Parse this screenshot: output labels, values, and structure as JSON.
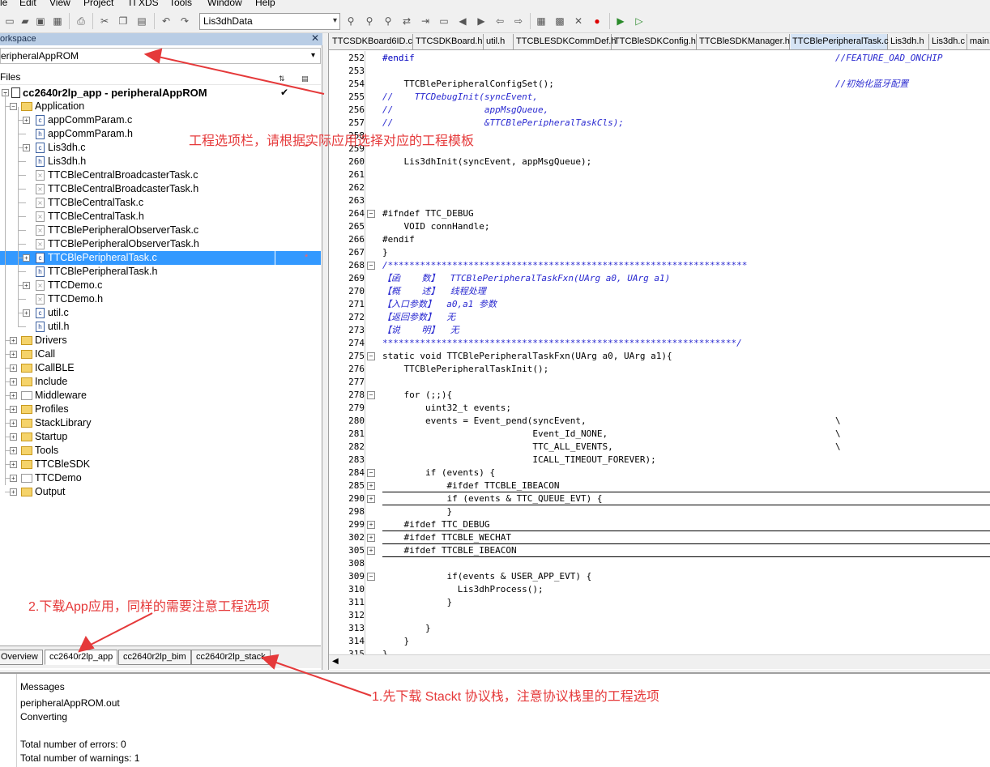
{
  "menu": [
    "le",
    "Edit",
    "View",
    "Project",
    "TI XDS",
    "Tools",
    "Window",
    "Help"
  ],
  "toolbar": {
    "config_combo": "Lis3dhData"
  },
  "workspace": {
    "title": "orkspace",
    "project_select": "eripheralAppROM",
    "files_label": "Files",
    "root": "cc2640r2lp_app - peripheralAppROM",
    "tree": [
      {
        "label": "Application",
        "kind": "folder",
        "level": 1,
        "exp": "−"
      },
      {
        "label": "appCommParam.c",
        "kind": "c",
        "level": 2,
        "exp": "+"
      },
      {
        "label": "appCommParam.h",
        "kind": "h",
        "level": 2,
        "exp": ""
      },
      {
        "label": "Lis3dh.c",
        "kind": "c",
        "level": 2,
        "exp": "+",
        "mark": "*"
      },
      {
        "label": "Lis3dh.h",
        "kind": "h",
        "level": 2,
        "exp": ""
      },
      {
        "label": "TTCBleCentralBroadcasterTask.c",
        "kind": "x",
        "level": 2,
        "exp": ""
      },
      {
        "label": "TTCBleCentralBroadcasterTask.h",
        "kind": "x",
        "level": 2,
        "exp": ""
      },
      {
        "label": "TTCBleCentralTask.c",
        "kind": "x",
        "level": 2,
        "exp": ""
      },
      {
        "label": "TTCBleCentralTask.h",
        "kind": "x",
        "level": 2,
        "exp": ""
      },
      {
        "label": "TTCBlePeripheralObserverTask.c",
        "kind": "x",
        "level": 2,
        "exp": ""
      },
      {
        "label": "TTCBlePeripheralObserverTask.h",
        "kind": "x",
        "level": 2,
        "exp": ""
      },
      {
        "label": "TTCBlePeripheralTask.c",
        "kind": "c",
        "level": 2,
        "exp": "+",
        "mark": "*",
        "selected": true
      },
      {
        "label": "TTCBlePeripheralTask.h",
        "kind": "h",
        "level": 2,
        "exp": ""
      },
      {
        "label": "TTCDemo.c",
        "kind": "x",
        "level": 2,
        "exp": "+"
      },
      {
        "label": "TTCDemo.h",
        "kind": "x",
        "level": 2,
        "exp": ""
      },
      {
        "label": "util.c",
        "kind": "c",
        "level": 2,
        "exp": "+"
      },
      {
        "label": "util.h",
        "kind": "h",
        "level": 2,
        "exp": ""
      },
      {
        "label": "Drivers",
        "kind": "folder",
        "level": 1,
        "exp": "+"
      },
      {
        "label": "ICall",
        "kind": "folder",
        "level": 1,
        "exp": "+"
      },
      {
        "label": "ICallBLE",
        "kind": "folder",
        "level": 1,
        "exp": "+"
      },
      {
        "label": "Include",
        "kind": "folder",
        "level": 1,
        "exp": "+"
      },
      {
        "label": "Middleware",
        "kind": "xfolder",
        "level": 1,
        "exp": "+"
      },
      {
        "label": "Profiles",
        "kind": "folder",
        "level": 1,
        "exp": "+"
      },
      {
        "label": "StackLibrary",
        "kind": "folder",
        "level": 1,
        "exp": "+"
      },
      {
        "label": "Startup",
        "kind": "folder",
        "level": 1,
        "exp": "+"
      },
      {
        "label": "Tools",
        "kind": "folder",
        "level": 1,
        "exp": "+"
      },
      {
        "label": "TTCBleSDK",
        "kind": "folder",
        "level": 1,
        "exp": "+"
      },
      {
        "label": "TTCDemo",
        "kind": "xfolder",
        "level": 1,
        "exp": "+"
      },
      {
        "label": "Output",
        "kind": "folder",
        "level": 1,
        "exp": "+"
      }
    ],
    "tabs": [
      "Overview",
      "cc2640r2lp_app",
      "cc2640r2lp_bim",
      "cc2640r2lp_stack"
    ]
  },
  "editor": {
    "tabs": [
      "TTCSDKBoard6ID.c",
      "TTCSDKBoard.h",
      "util.h",
      "TTCBLESDKCommDef.h",
      "TTCBleSDKConfig.h",
      "TTCBleSDKManager.h",
      "TTCBlePeripheralTask.c",
      "Lis3dh.h",
      "Lis3dh.c",
      "main.c"
    ],
    "active_tab": 6,
    "lines": [
      {
        "n": "252",
        "code": "#endif",
        "cls": "pp",
        "right": "//FEATURE_OAD_ONCHIP",
        "rcls": "cm"
      },
      {
        "n": "253",
        "code": ""
      },
      {
        "n": "254",
        "code": "    TTCBlePeripheralConfigSet();",
        "right": "//初始化蓝牙配置",
        "rcls": "cm"
      },
      {
        "n": "255",
        "code": "//    TTCDebugInit(syncEvent,",
        "cls": "co"
      },
      {
        "n": "256",
        "code": "//                 appMsgQueue,",
        "cls": "co"
      },
      {
        "n": "257",
        "code": "//                 &TTCBlePeripheralTaskCls);",
        "cls": "co"
      },
      {
        "n": "258",
        "code": ""
      },
      {
        "n": "259",
        "code": ""
      },
      {
        "n": "260",
        "code": "    Lis3dhInit(syncEvent, appMsgQueue);"
      },
      {
        "n": "261",
        "code": ""
      },
      {
        "n": "262",
        "code": ""
      },
      {
        "n": "263",
        "code": ""
      },
      {
        "n": "264",
        "code": "#ifndef TTC_DEBUG",
        "fold": "−"
      },
      {
        "n": "265",
        "code": "    VOID connHandle;"
      },
      {
        "n": "266",
        "code": "#endif"
      },
      {
        "n": "267",
        "code": "}"
      },
      {
        "n": "268",
        "code": "/*******************************************************************",
        "cls": "co",
        "fold": "−"
      },
      {
        "n": "269",
        "code": "【函    数】  TTCBlePeripheralTaskFxn(UArg a0, UArg a1)",
        "cls": "co"
      },
      {
        "n": "270",
        "code": "【概    述】  线程处理",
        "cls": "co"
      },
      {
        "n": "271",
        "code": "【入口参数】  a0,a1 参数",
        "cls": "co"
      },
      {
        "n": "272",
        "code": "【返回参数】  无",
        "cls": "co"
      },
      {
        "n": "273",
        "code": "【说    明】  无",
        "cls": "co"
      },
      {
        "n": "274",
        "code": "******************************************************************/",
        "cls": "co"
      },
      {
        "n": "275",
        "code": "static void TTCBlePeripheralTaskFxn(UArg a0, UArg a1){",
        "fold": "−"
      },
      {
        "n": "276",
        "code": "    TTCBlePeripheralTaskInit();"
      },
      {
        "n": "277",
        "code": ""
      },
      {
        "n": "278",
        "code": "    for (;;){",
        "fold": "−"
      },
      {
        "n": "279",
        "code": "        uint32_t events;"
      },
      {
        "n": "280",
        "code": "        events = Event_pend(syncEvent,",
        "right": "\\",
        "rcls": "bs"
      },
      {
        "n": "281",
        "code": "                            Event_Id_NONE,",
        "right": "\\",
        "rcls": "bs"
      },
      {
        "n": "282",
        "code": "                            TTC_ALL_EVENTS,",
        "right": "\\",
        "rcls": "bs"
      },
      {
        "n": "283",
        "code": "                            ICALL_TIMEOUT_FOREVER);"
      },
      {
        "n": "284",
        "code": "        if (events) {",
        "fold": "−"
      },
      {
        "n": "285",
        "code": "            #ifdef TTCBLE_IBEACON",
        "fold": "+",
        "uline": true
      },
      {
        "n": "290",
        "code": "            if (events & TTC_QUEUE_EVT) {",
        "fold": "+",
        "uline": true
      },
      {
        "n": "298",
        "code": "            }"
      },
      {
        "n": "299",
        "code": "    #ifdef TTC_DEBUG",
        "fold": "+",
        "uline": true
      },
      {
        "n": "302",
        "code": "    #ifdef TTCBLE_WECHAT",
        "fold": "+",
        "uline": true
      },
      {
        "n": "305",
        "code": "    #ifdef TTCBLE_IBEACON",
        "fold": "+",
        "uline": true
      },
      {
        "n": "308",
        "code": ""
      },
      {
        "n": "309",
        "code": "            if(events & USER_APP_EVT) {",
        "fold": "−"
      },
      {
        "n": "310",
        "code": "              Lis3dhProcess();"
      },
      {
        "n": "311",
        "code": "            }"
      },
      {
        "n": "312",
        "code": ""
      },
      {
        "n": "313",
        "code": "        }"
      },
      {
        "n": "314",
        "code": "    }"
      },
      {
        "n": "315",
        "code": "}"
      }
    ]
  },
  "messages": {
    "title": "Messages",
    "lines": [
      "peripheralAppROM.out",
      "Converting",
      "",
      "Total number of errors: 0",
      "Total number of warnings: 1"
    ]
  },
  "annotations": {
    "project_select": "工程选项栏，请根据实际应用选择对应的工程模板",
    "download_app": "2.下载App应用，同样的需要注意工程选项",
    "download_stack": "1.先下载 Stackt 协议栈，注意协议栈里的工程选项"
  },
  "colors": {
    "annotation": "#e5393a",
    "selection": "#3399ff",
    "workspace_title": "#b9cde5",
    "active_tab": "#d6e4f5"
  }
}
